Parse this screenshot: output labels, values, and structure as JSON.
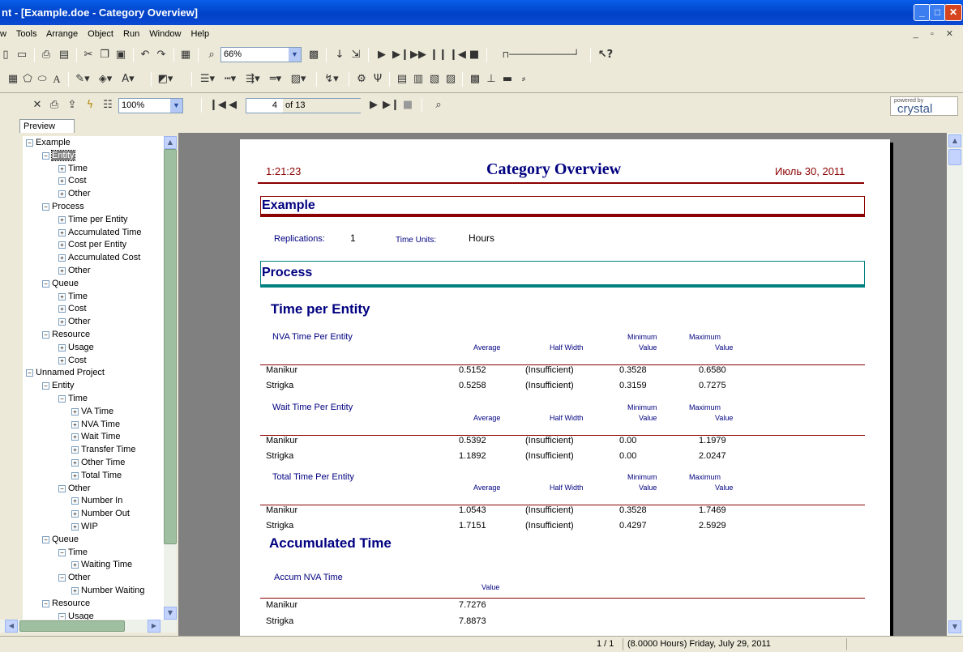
{
  "window": {
    "title": "nt - [Example.doe - Category Overview]"
  },
  "menu": [
    "w",
    "Tools",
    "Arrange",
    "Object",
    "Run",
    "Window",
    "Help"
  ],
  "toolbar": {
    "zoom": "66%"
  },
  "report_toolbar": {
    "zoom": "100%",
    "page_current": "4",
    "page_total": "of 13"
  },
  "branding": {
    "powered_by": "powered by",
    "brand": "crystal"
  },
  "tabs": {
    "preview": "Preview"
  },
  "tree": [
    {
      "label": "Example",
      "depth": 0,
      "sign": "minus"
    },
    {
      "label": "Entity",
      "depth": 1,
      "sign": "minus",
      "selected": true
    },
    {
      "label": "Time",
      "depth": 2,
      "sign": "plus"
    },
    {
      "label": "Cost",
      "depth": 2,
      "sign": "plus"
    },
    {
      "label": "Other",
      "depth": 2,
      "sign": "plus"
    },
    {
      "label": "Process",
      "depth": 1,
      "sign": "minus"
    },
    {
      "label": "Time per Entity",
      "depth": 2,
      "sign": "plus"
    },
    {
      "label": "Accumulated Time",
      "depth": 2,
      "sign": "plus"
    },
    {
      "label": "Cost per Entity",
      "depth": 2,
      "sign": "plus"
    },
    {
      "label": "Accumulated Cost",
      "depth": 2,
      "sign": "plus"
    },
    {
      "label": "Other",
      "depth": 2,
      "sign": "plus"
    },
    {
      "label": "Queue",
      "depth": 1,
      "sign": "minus"
    },
    {
      "label": "Time",
      "depth": 2,
      "sign": "plus"
    },
    {
      "label": "Cost",
      "depth": 2,
      "sign": "plus"
    },
    {
      "label": "Other",
      "depth": 2,
      "sign": "plus"
    },
    {
      "label": "Resource",
      "depth": 1,
      "sign": "minus"
    },
    {
      "label": "Usage",
      "depth": 2,
      "sign": "plus"
    },
    {
      "label": "Cost",
      "depth": 2,
      "sign": "plus"
    },
    {
      "label": "Unnamed Project",
      "depth": 0,
      "sign": "minus"
    },
    {
      "label": "Entity",
      "depth": 1,
      "sign": "minus"
    },
    {
      "label": "Time",
      "depth": 2,
      "sign": "minus"
    },
    {
      "label": "VA Time",
      "depth": 3,
      "sign": "plus"
    },
    {
      "label": "NVA Time",
      "depth": 3,
      "sign": "plus"
    },
    {
      "label": "Wait Time",
      "depth": 3,
      "sign": "plus"
    },
    {
      "label": "Transfer Time",
      "depth": 3,
      "sign": "plus"
    },
    {
      "label": "Other Time",
      "depth": 3,
      "sign": "plus"
    },
    {
      "label": "Total Time",
      "depth": 3,
      "sign": "plus"
    },
    {
      "label": "Other",
      "depth": 2,
      "sign": "minus"
    },
    {
      "label": "Number In",
      "depth": 3,
      "sign": "plus"
    },
    {
      "label": "Number Out",
      "depth": 3,
      "sign": "plus"
    },
    {
      "label": "WIP",
      "depth": 3,
      "sign": "plus"
    },
    {
      "label": "Queue",
      "depth": 1,
      "sign": "minus"
    },
    {
      "label": "Time",
      "depth": 2,
      "sign": "minus"
    },
    {
      "label": "Waiting Time",
      "depth": 3,
      "sign": "plus"
    },
    {
      "label": "Other",
      "depth": 2,
      "sign": "minus"
    },
    {
      "label": "Number Waiting",
      "depth": 3,
      "sign": "plus"
    },
    {
      "label": "Resource",
      "depth": 1,
      "sign": "minus"
    },
    {
      "label": "Usage",
      "depth": 2,
      "sign": "minus"
    }
  ],
  "report": {
    "time": "1:21:23",
    "title": "Category Overview",
    "date": "Июль 30, 2011",
    "model": "Example",
    "replications_label": "Replications:",
    "replications_value": "1",
    "time_units_label": "Time Units:",
    "time_units_value": "Hours",
    "section": "Process",
    "sub1": "Time per Entity",
    "col_average": "Average",
    "col_half_width": "Half Width",
    "col_min1": "Minimum",
    "col_min2": "Value",
    "col_max1": "Maximum",
    "col_max2": "Value",
    "tables": [
      {
        "name": "NVA Time Per Entity",
        "rows": [
          [
            "Manikur",
            "0.5152",
            "(Insufficient)",
            "0.3528",
            "0.6580"
          ],
          [
            "Strigka",
            "0.5258",
            "(Insufficient)",
            "0.3159",
            "0.7275"
          ]
        ]
      },
      {
        "name": "Wait Time Per Entity",
        "rows": [
          [
            "Manikur",
            "0.5392",
            "(Insufficient)",
            "0.00",
            "1.1979"
          ],
          [
            "Strigka",
            "1.1892",
            "(Insufficient)",
            "0.00",
            "2.0247"
          ]
        ]
      },
      {
        "name": "Total Time Per Entity",
        "rows": [
          [
            "Manikur",
            "1.0543",
            "(Insufficient)",
            "0.3528",
            "1.7469"
          ],
          [
            "Strigka",
            "1.7151",
            "(Insufficient)",
            "0.4297",
            "2.5929"
          ]
        ]
      }
    ],
    "sub2": "Accumulated Time",
    "accum_name": "Accum NVA Time",
    "accum_col": "Value",
    "accum_rows": [
      [
        "Manikur",
        "7.7276"
      ],
      [
        "Strigka",
        "7.8873"
      ]
    ]
  },
  "status": {
    "pages": "1 / 1",
    "sim_time": "(8.0000 Hours) Friday, July 29, 2011"
  },
  "colors": {
    "report_navy": "#000080",
    "report_red": "#8b0000",
    "process_teal": "#008080"
  }
}
